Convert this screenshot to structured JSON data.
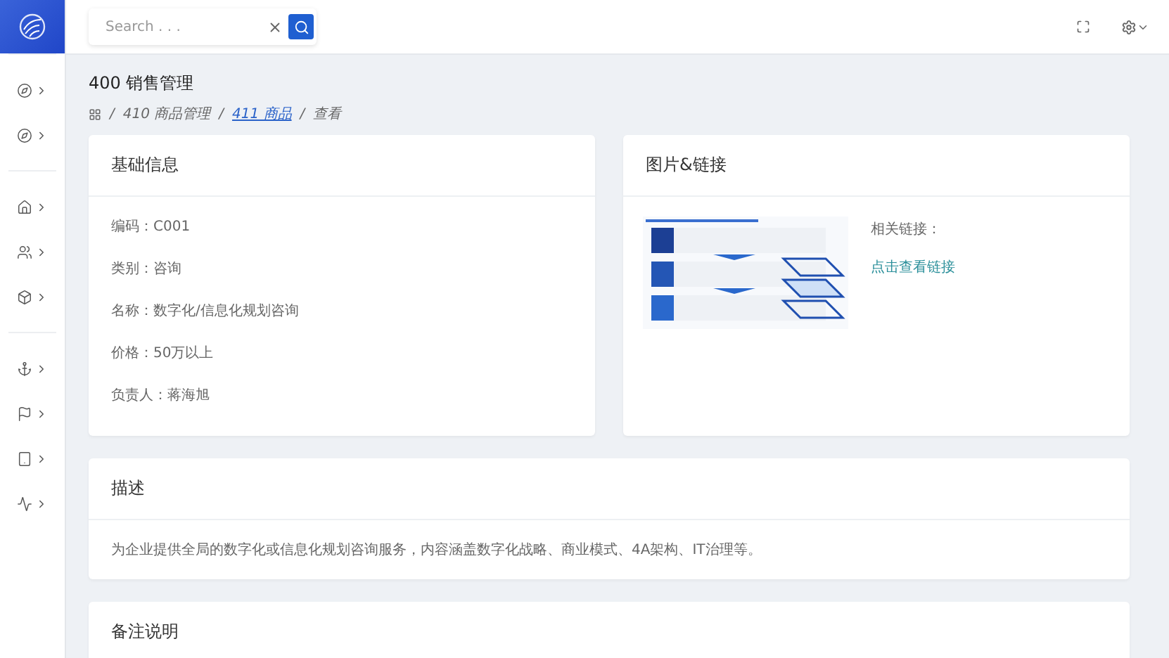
{
  "search": {
    "placeholder": "Search . . ."
  },
  "sidebar": {
    "groups": [
      {
        "items": [
          {
            "kind": "compass"
          },
          {
            "kind": "compass"
          }
        ]
      },
      {
        "items": [
          {
            "kind": "home"
          },
          {
            "kind": "users"
          },
          {
            "kind": "box"
          }
        ]
      },
      {
        "items": [
          {
            "kind": "anchor"
          },
          {
            "kind": "flag"
          },
          {
            "kind": "tablet"
          },
          {
            "kind": "activity"
          }
        ]
      }
    ]
  },
  "page": {
    "title": "400 销售管理",
    "breadcrumb": [
      {
        "separator": "/",
        "text": "410 商品管理",
        "link": false
      },
      {
        "separator": "/",
        "text": "411 商品",
        "link": true
      },
      {
        "separator": "/",
        "text": "查看",
        "link": false
      }
    ]
  },
  "basic_info": {
    "title": "基础信息",
    "fields": [
      "编码：C001",
      "类别：咨询",
      "名称：数字化/信息化规划咨询",
      "价格：50万以上",
      "负责人：蒋海旭"
    ]
  },
  "media": {
    "title": "图片&链接",
    "links_label": "相关链接：",
    "link": "点击查看链接"
  },
  "description": {
    "title": "描述",
    "text": "为企业提供全局的数字化或信息化规划咨询服务，内容涵盖数字化战略、商业模式、4A架构、IT治理等。"
  },
  "remarks": {
    "title": "备注说明"
  }
}
